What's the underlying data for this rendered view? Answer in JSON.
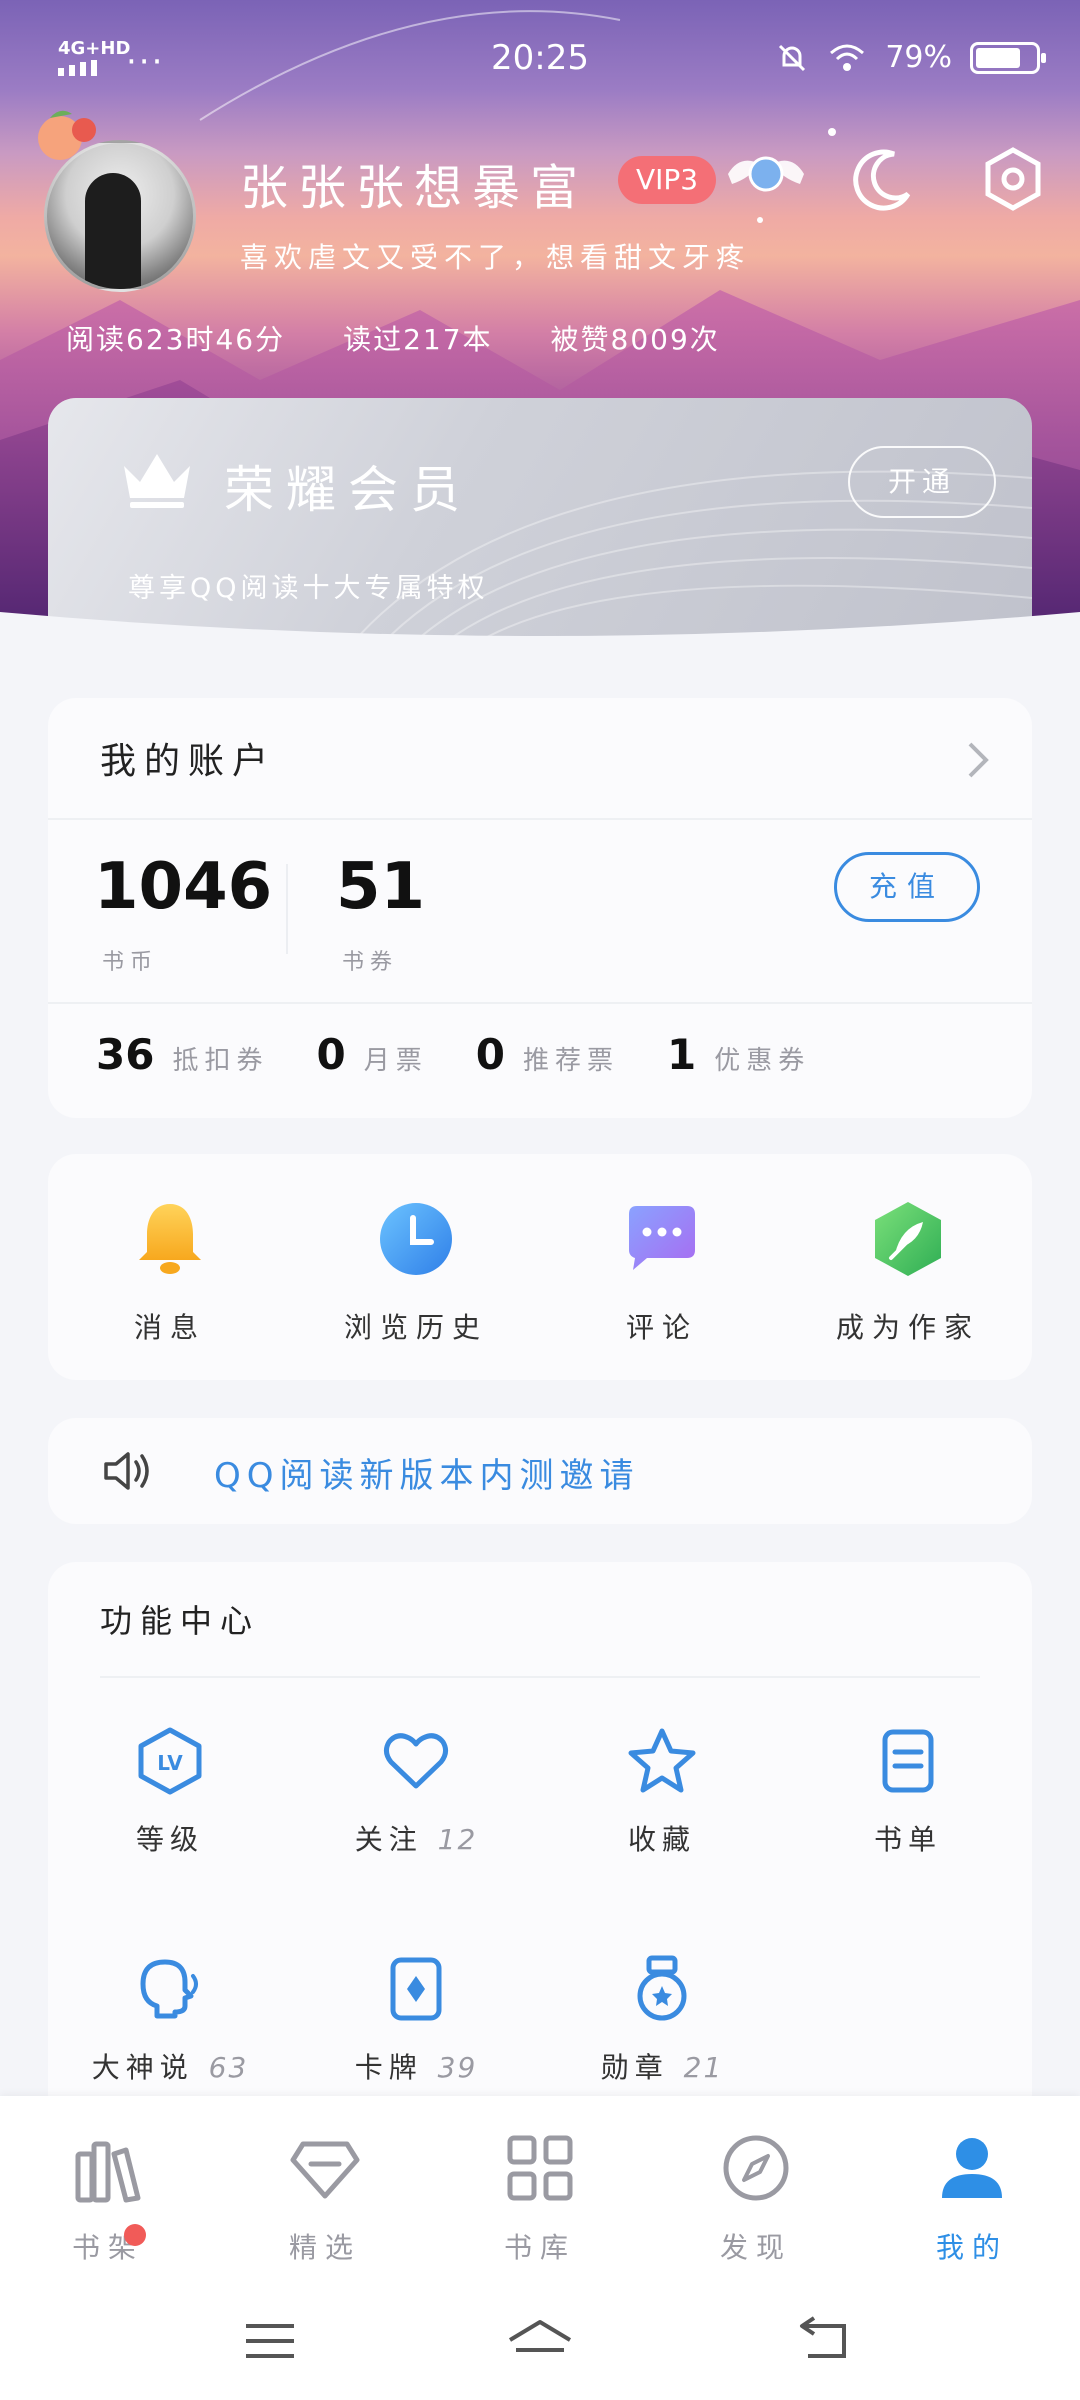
{
  "status_bar": {
    "network": "4G+HD",
    "dots": "···",
    "time": "20:25",
    "battery": "79%"
  },
  "profile": {
    "username": "张张张想暴富",
    "vip_level": "VIP3",
    "signature": "喜欢虐文又受不了，想看甜文牙疼",
    "stats": [
      "阅读623时46分",
      "读过217本",
      "被赞8009次"
    ]
  },
  "membership": {
    "title": "荣耀会员",
    "open_label": "开通",
    "subtitle": "尊享QQ阅读十大专属特权"
  },
  "account": {
    "title": "我的账户",
    "coins": {
      "value": "1046",
      "label": "书币"
    },
    "vouchers": {
      "value": "51",
      "label": "书券"
    },
    "recharge_label": "充值",
    "coupons": [
      {
        "count": "36",
        "label": "抵扣券"
      },
      {
        "count": "0",
        "label": "月票"
      },
      {
        "count": "0",
        "label": "推荐票"
      },
      {
        "count": "1",
        "label": "优惠券"
      }
    ]
  },
  "quick_actions": [
    {
      "label": "消息",
      "icon": "bell-icon"
    },
    {
      "label": "浏览历史",
      "icon": "clock-icon"
    },
    {
      "label": "评论",
      "icon": "chat-icon"
    },
    {
      "label": "成为作家",
      "icon": "quill-icon"
    }
  ],
  "notice": {
    "text": "QQ阅读新版本内测邀请",
    "icon": "speaker-icon"
  },
  "function_center": {
    "title": "功能中心",
    "items": [
      {
        "label": "等级",
        "count": "",
        "icon": "level-icon"
      },
      {
        "label": "关注",
        "count": "12",
        "icon": "heart-icon"
      },
      {
        "label": "收藏",
        "count": "",
        "icon": "star-icon"
      },
      {
        "label": "书单",
        "count": "",
        "icon": "booklist-icon"
      },
      {
        "label": "大神说",
        "count": "63",
        "icon": "speak-icon"
      },
      {
        "label": "卡牌",
        "count": "39",
        "icon": "card-icon"
      },
      {
        "label": "勋章",
        "count": "21",
        "icon": "medal-icon"
      }
    ]
  },
  "tabs": [
    {
      "label": "书架",
      "icon": "bookshelf-icon",
      "active": false
    },
    {
      "label": "精选",
      "icon": "diamond-icon",
      "active": false
    },
    {
      "label": "书库",
      "icon": "grid-icon",
      "active": false
    },
    {
      "label": "发现",
      "icon": "compass-icon",
      "active": false
    },
    {
      "label": "我的",
      "icon": "user-icon",
      "active": true
    }
  ],
  "colors": {
    "accent": "#2e8fe6",
    "vip_badge": "#f46f76",
    "badge_dot": "#f15b58"
  }
}
